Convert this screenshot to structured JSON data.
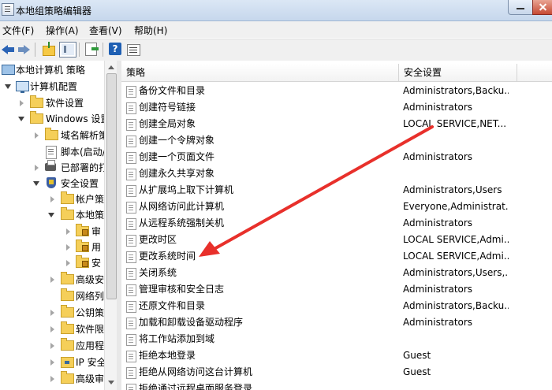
{
  "window": {
    "title": "本地组策略编辑器"
  },
  "menu": [
    "文件(F)",
    "操作(A)",
    "查看(V)",
    "帮助(H)"
  ],
  "toolbar": {
    "icons": [
      "back-icon",
      "forward-icon",
      "up-folder-icon",
      "show-tree-icon",
      "export-list-icon",
      "help-icon",
      "properties-icon"
    ],
    "help_label": "?"
  },
  "tree": [
    {
      "label": "本地计算机 策略",
      "icon": "computer-icon",
      "state": "none"
    },
    {
      "label": "计算机配置",
      "icon": "monitor-icon",
      "state": "expanded"
    },
    {
      "label": "软件设置",
      "icon": "folder-icon",
      "state": "collapsed"
    },
    {
      "label": "Windows 设置",
      "icon": "folder-icon",
      "state": "expanded"
    },
    {
      "label": "域名解析策",
      "icon": "folder-icon",
      "state": "collapsed"
    },
    {
      "label": "脚本(启动/",
      "icon": "doc-icon",
      "state": "none"
    },
    {
      "label": "已部署的打",
      "icon": "printer-icon",
      "state": "collapsed"
    },
    {
      "label": "安全设置",
      "icon": "shield-icon",
      "state": "expanded"
    },
    {
      "label": "帐户策",
      "icon": "folder-icon",
      "state": "collapsed"
    },
    {
      "label": "本地策",
      "icon": "folder-icon",
      "state": "expanded"
    },
    {
      "label": "审",
      "icon": "lock-folder-icon",
      "state": "collapsed"
    },
    {
      "label": "用",
      "icon": "lock-folder-icon",
      "state": "collapsed"
    },
    {
      "label": "安",
      "icon": "lock-folder-icon",
      "state": "collapsed"
    },
    {
      "label": "高级安",
      "icon": "folder-icon",
      "state": "collapsed"
    },
    {
      "label": "网络列",
      "icon": "folder-icon",
      "state": "none"
    },
    {
      "label": "公钥策",
      "icon": "folder-icon",
      "state": "collapsed"
    },
    {
      "label": "软件限",
      "icon": "folder-icon",
      "state": "collapsed"
    },
    {
      "label": "应用程",
      "icon": "folder-icon",
      "state": "collapsed"
    },
    {
      "label": "IP 安全",
      "icon": "network-icon",
      "state": "collapsed"
    },
    {
      "label": "高级审",
      "icon": "folder-icon",
      "state": "collapsed"
    }
  ],
  "list": {
    "headers": [
      "策略",
      "安全设置"
    ],
    "rows": [
      {
        "policy": "备份文件和目录",
        "setting": "Administrators,Backu..."
      },
      {
        "policy": "创建符号链接",
        "setting": "Administrators"
      },
      {
        "policy": "创建全局对象",
        "setting": "LOCAL SERVICE,NET..."
      },
      {
        "policy": "创建一个令牌对象",
        "setting": ""
      },
      {
        "policy": "创建一个页面文件",
        "setting": "Administrators"
      },
      {
        "policy": "创建永久共享对象",
        "setting": ""
      },
      {
        "policy": "从扩展坞上取下计算机",
        "setting": "Administrators,Users"
      },
      {
        "policy": "从网络访问此计算机",
        "setting": "Everyone,Administrat..."
      },
      {
        "policy": "从远程系统强制关机",
        "setting": "Administrators"
      },
      {
        "policy": "更改时区",
        "setting": "LOCAL SERVICE,Admi..."
      },
      {
        "policy": "更改系统时间",
        "setting": "LOCAL SERVICE,Admi..."
      },
      {
        "policy": "关闭系统",
        "setting": "Administrators,Users,..."
      },
      {
        "policy": "管理审核和安全日志",
        "setting": "Administrators"
      },
      {
        "policy": "还原文件和目录",
        "setting": "Administrators,Backu..."
      },
      {
        "policy": "加载和卸载设备驱动程序",
        "setting": "Administrators"
      },
      {
        "policy": "将工作站添加到域",
        "setting": ""
      },
      {
        "policy": "拒绝本地登录",
        "setting": "Guest"
      },
      {
        "policy": "拒绝从网络访问这台计算机",
        "setting": "Guest"
      },
      {
        "policy": "拒绝通过远程桌面服务登录",
        "setting": ""
      }
    ]
  },
  "annotation": {
    "color": "#e8302b"
  }
}
